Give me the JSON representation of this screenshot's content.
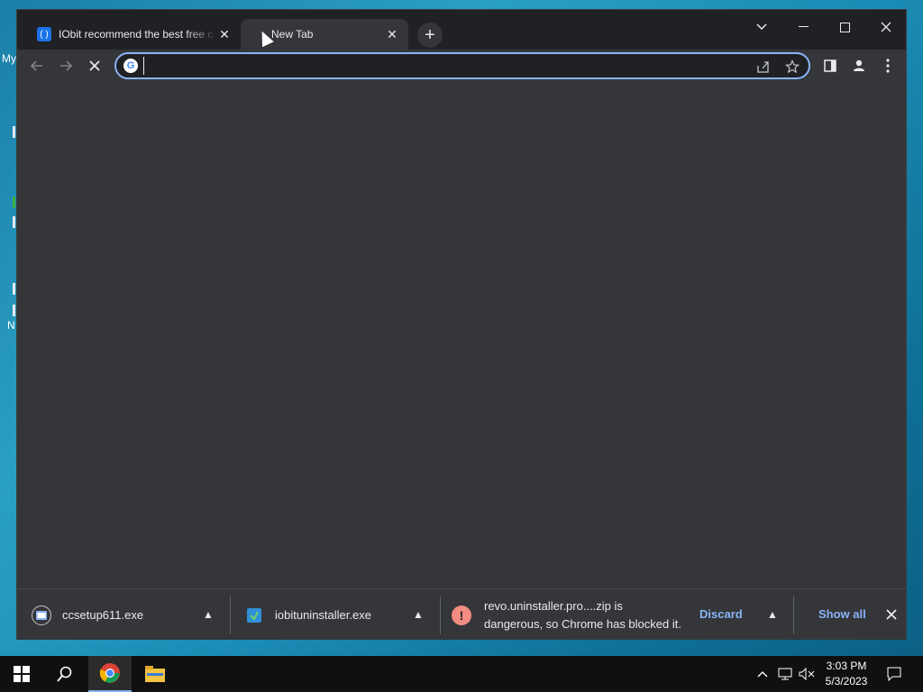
{
  "desktop": {
    "fragment_top": "My",
    "fragment_mid": "N"
  },
  "tabs": [
    {
      "title": "IObit recommend the best free c",
      "favicon": "iobit-favicon",
      "active": false
    },
    {
      "title": "New Tab",
      "favicon": "none",
      "active": true
    }
  ],
  "toolbar": {
    "back_icon": "back-arrow-icon",
    "forward_icon": "forward-arrow-icon",
    "stop_icon": "stop-loading-icon",
    "address_value": "",
    "address_placeholder": "",
    "google_glyph": "G"
  },
  "downloads": {
    "items": [
      {
        "name": "ccsetup611.exe",
        "icon": "ccleaner-installer-icon"
      },
      {
        "name": "iobituninstaller.exe",
        "icon": "iobit-installer-icon"
      }
    ],
    "warning": {
      "line1": "revo.uninstaller.pro....zip is",
      "line2": "dangerous, so Chrome has blocked it.",
      "discard_label": "Discard"
    },
    "show_all_label": "Show all"
  },
  "taskbar": {
    "time": "3:03 PM",
    "date": "5/3/2023"
  },
  "colors": {
    "accent": "#8ab4f8",
    "warning": "#f28b82",
    "chrome_dark": "#35363a"
  }
}
